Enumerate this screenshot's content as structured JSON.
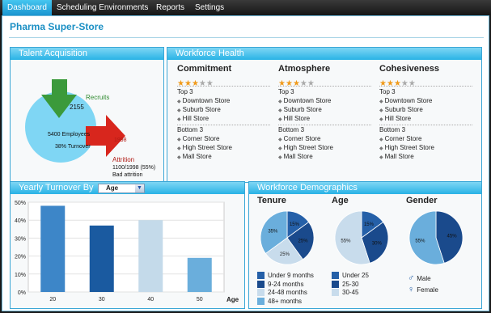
{
  "nav": {
    "tabs": [
      "Dashboard",
      "Scheduling Environments",
      "Reports",
      "Settings"
    ],
    "active": "Dashboard"
  },
  "store_title": "Pharma Super-Store",
  "talent": {
    "title": "Talent Acquisition",
    "recruits_label": "Recruits",
    "recruits_value": "2155",
    "employees": "5400 Employees",
    "turnover": "38% Turnover",
    "attrition_value": "1998",
    "attrition_label": "Attrition",
    "bad_attrition_value": "1100/1998 (55%)",
    "bad_attrition_label": "Bad attrition"
  },
  "health": {
    "title": "Workforce Health",
    "top_label": "Top 3",
    "bottom_label": "Bottom 3",
    "columns": [
      {
        "name": "Commitment",
        "stars": 3,
        "top": [
          "Downtown Store",
          "Suburb Store",
          "Hill Store"
        ],
        "bottom": [
          "Corner Store",
          "High Street Store",
          "Mall Store"
        ]
      },
      {
        "name": "Atmosphere",
        "stars": 3,
        "top": [
          "Downtown Store",
          "Suburb Store",
          "Hill Store"
        ],
        "bottom": [
          "Corner Store",
          "High Street Store",
          "Mall Store"
        ]
      },
      {
        "name": "Cohesiveness",
        "stars": 3,
        "top": [
          "Downtown Store",
          "Suburb Store",
          "Hill Store"
        ],
        "bottom": [
          "Corner Store",
          "High Street Store",
          "Mall Store"
        ]
      }
    ]
  },
  "turnover": {
    "title": "Yearly Turnover By",
    "select_value": "Age"
  },
  "demographics": {
    "title": "Workforce Demographics",
    "charts": [
      {
        "title": "Tenure",
        "slices": [
          {
            "label": "Under 9 months",
            "value": 15,
            "color": "#2560a8"
          },
          {
            "label": "9-24 months",
            "value": 25,
            "color": "#1a4a8c"
          },
          {
            "label": "24-48 months",
            "value": 25,
            "color": "#c8dcec"
          },
          {
            "label": "48+ months",
            "value": 35,
            "color": "#6aaedc"
          }
        ]
      },
      {
        "title": "Age",
        "slices": [
          {
            "label": "Under 25",
            "value": 15,
            "color": "#2560a8"
          },
          {
            "label": "25-30",
            "value": 30,
            "color": "#1a4a8c"
          },
          {
            "label": "30-45",
            "value": 55,
            "color": "#c8dcec"
          }
        ]
      },
      {
        "title": "Gender",
        "slices": [
          {
            "label": "Male",
            "value": 45,
            "color": "#1a4a8c"
          },
          {
            "label": "Female",
            "value": 55,
            "color": "#6aaedc"
          }
        ]
      }
    ],
    "gender_legend": [
      {
        "label": "Male",
        "symbol": "♂"
      },
      {
        "label": "Female",
        "symbol": "♀"
      }
    ]
  },
  "chart_data": {
    "type": "bar",
    "categories": [
      "20",
      "30",
      "40",
      "50"
    ],
    "values": [
      48,
      37,
      40,
      19
    ],
    "bar_colors": [
      "#3d86c8",
      "#1a5aa0",
      "#c4daea",
      "#6aaedc"
    ],
    "xlabel": "Age",
    "ylabel": "",
    "ylim": [
      0,
      50
    ],
    "yticks": [
      "0%",
      "10%",
      "20%",
      "30%",
      "40%",
      "50%"
    ],
    "grid": true
  }
}
